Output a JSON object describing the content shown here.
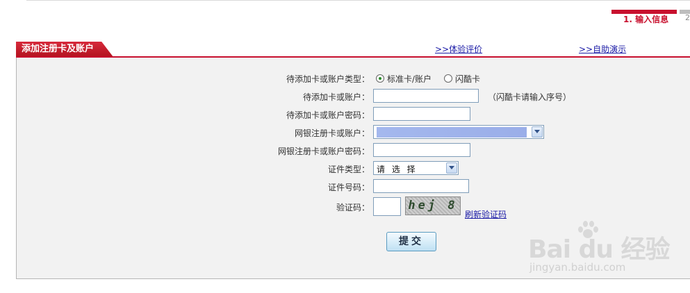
{
  "steps": {
    "current_label": "1. 输入信息",
    "next_num": "2"
  },
  "header": {
    "tab_title": "添加注册卡及账户",
    "links": {
      "experience": "体验评价",
      "demo": "自助演示",
      "arrow": ">>"
    }
  },
  "form": {
    "type_label": "待添加卡或账户类型：",
    "type_options": [
      "标准卡/账户",
      "闪酷卡"
    ],
    "card_label": "待添加卡或账户：",
    "card_hint": "（闪酷卡请输入序号）",
    "password_label": "待添加卡或账户密码：",
    "reg_card_label": "网银注册卡或账户：",
    "reg_password_label": "网银注册卡或账户密码：",
    "id_type_label": "证件类型：",
    "id_type_value": "请 选 择",
    "id_number_label": "证件号码：",
    "captcha_label": "验证码：",
    "captcha_text": "hej 8",
    "refresh_label": "刷新验证码",
    "submit_label": "提交"
  },
  "watermark": {
    "brand": "Bai du 经验",
    "url": "jingyan.baidu.com"
  },
  "colors": {
    "accent": "#c8102e",
    "link": "#1a1aa6",
    "panel": "#f2f2f2"
  }
}
